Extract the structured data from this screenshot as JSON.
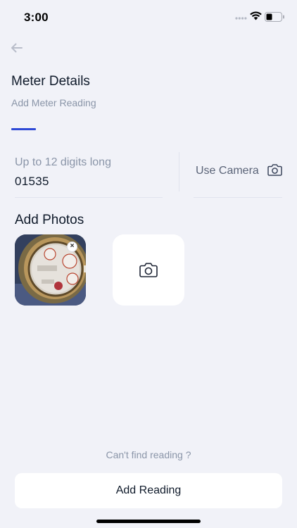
{
  "status_bar": {
    "time": "3:00"
  },
  "header": {
    "back_icon": "arrow-left-icon",
    "title": "Meter Details",
    "subtitle": "Add Meter Reading"
  },
  "reading": {
    "label": "Up to 12 digits long",
    "value": "01535",
    "camera_label": "Use Camera",
    "camera_icon": "camera-icon"
  },
  "photos": {
    "title": "Add Photos",
    "remove_icon_text": "×",
    "add_icon": "camera-icon"
  },
  "footer": {
    "cant_find": "Can't find reading ?",
    "add_button": "Add Reading"
  },
  "colors": {
    "background": "#f1f2f8",
    "accent": "#2e49d6",
    "card": "#ffffff",
    "muted_text": "#8a95a8"
  }
}
